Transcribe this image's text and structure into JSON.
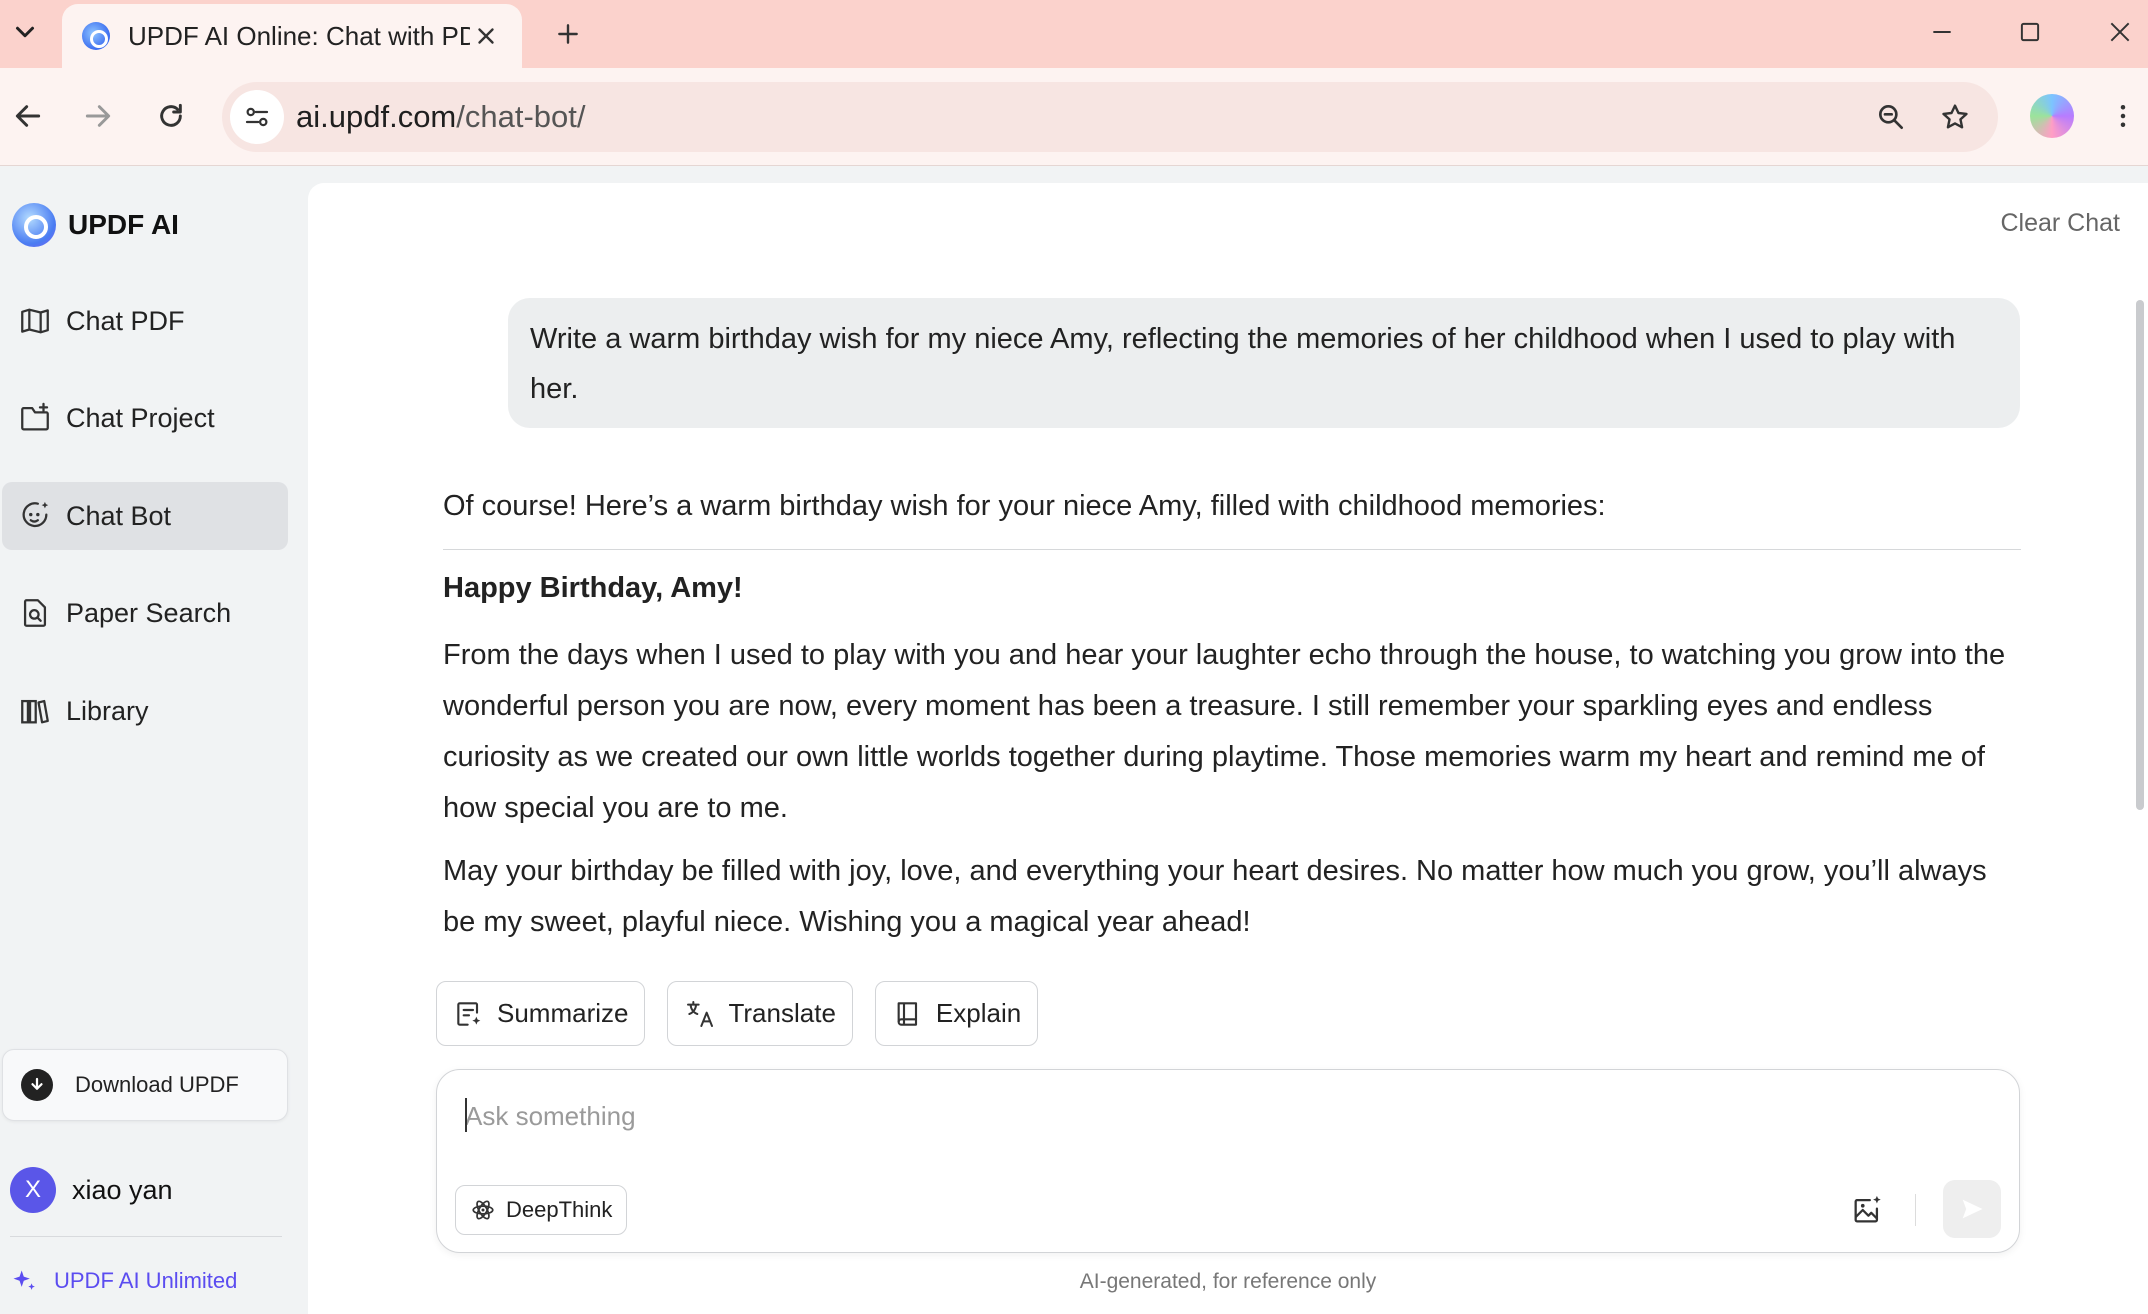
{
  "browser": {
    "tab_title": "UPDF AI Online: Chat with PDF",
    "url_host": "ai.updf.com",
    "url_path": "/chat-bot/"
  },
  "sidebar": {
    "brand": "UPDF AI",
    "items": [
      {
        "label": "Chat PDF",
        "icon": "book-open-icon"
      },
      {
        "label": "Chat Project",
        "icon": "folder-plus-icon"
      },
      {
        "label": "Chat Bot",
        "icon": "bot-face-icon",
        "active": true
      },
      {
        "label": "Paper Search",
        "icon": "document-search-icon"
      },
      {
        "label": "Library",
        "icon": "library-icon"
      }
    ],
    "download_label": "Download UPDF",
    "user": {
      "initial": "X",
      "name": "xiao yan"
    },
    "plan_label": "UPDF AI Unlimited"
  },
  "main": {
    "clear_chat": "Clear Chat",
    "user_message": "Write a warm birthday wish for my niece Amy, reflecting the memories of her childhood when I used to play with her.",
    "reply": {
      "intro": "Of course! Here’s a warm birthday wish for your niece Amy, filled with childhood memories:",
      "title": "Happy Birthday, Amy!",
      "paragraph_1": "From the days when I used to play with you and hear your laughter echo through the house, to watching you grow into the wonderful person you are now, every moment has been a treasure. I still remember your sparkling eyes and endless curiosity as we created our own little worlds together during playtime. Those memories warm my heart and remind me of how special you are to me.",
      "paragraph_2": "May your birthday be filled with joy, love, and everything your heart desires. No matter how much you grow, you’ll always be my sweet, playful niece. Wishing you a magical year ahead!"
    },
    "actions": {
      "summarize": "Summarize",
      "translate": "Translate",
      "explain": "Explain"
    },
    "composer": {
      "placeholder": "Ask something",
      "value": "",
      "deepthink": "DeepThink"
    },
    "disclaimer": "AI-generated, for reference only"
  },
  "colors": {
    "tabbar": "#fbd2cc",
    "accent": "#5b4cf0",
    "active_nav": "#dfe1e4"
  }
}
